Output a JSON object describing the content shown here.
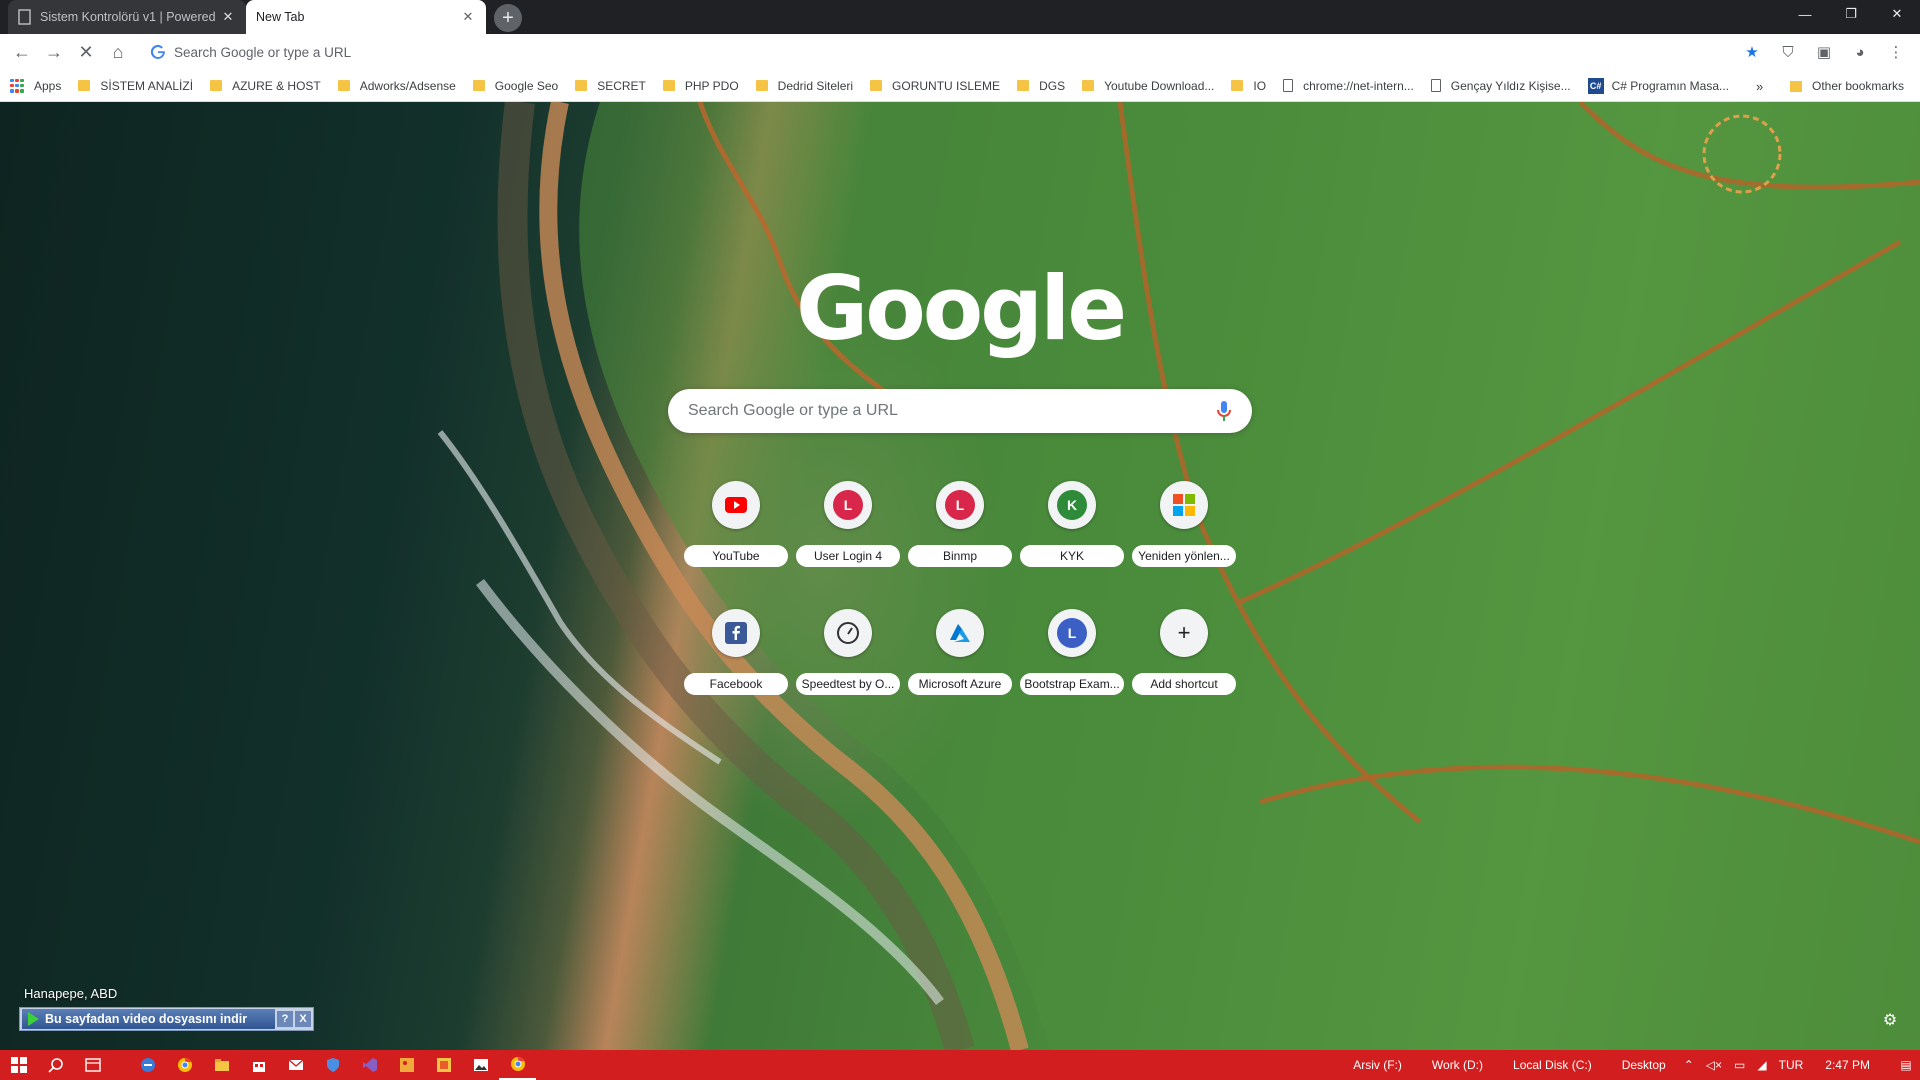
{
  "tabs": [
    {
      "title": "Sistem Kontrolörü v1 | Powered",
      "active": false
    },
    {
      "title": "New Tab",
      "active": true
    }
  ],
  "toolbar": {
    "omnibox_placeholder": "Search Google or type a URL"
  },
  "bookmarks": [
    {
      "label": "Apps",
      "icon": "apps-grid-icon"
    },
    {
      "label": "SİSTEM ANALİZİ",
      "icon": "folder-icon"
    },
    {
      "label": "AZURE & HOST",
      "icon": "folder-icon"
    },
    {
      "label": "Adworks/Adsense",
      "icon": "folder-icon"
    },
    {
      "label": "Google Seo",
      "icon": "folder-icon"
    },
    {
      "label": "SECRET",
      "icon": "folder-icon"
    },
    {
      "label": "PHP PDO",
      "icon": "folder-icon"
    },
    {
      "label": "Dedrid Siteleri",
      "icon": "folder-icon"
    },
    {
      "label": "GORUNTU ISLEME",
      "icon": "folder-icon"
    },
    {
      "label": "DGS",
      "icon": "folder-icon"
    },
    {
      "label": "Youtube Download...",
      "icon": "folder-icon"
    },
    {
      "label": "IO",
      "icon": "folder-icon"
    },
    {
      "label": "chrome://net-intern...",
      "icon": "page-icon"
    },
    {
      "label": "Gençay Yıldız Kişise...",
      "icon": "page-icon"
    },
    {
      "label": "C# Programın Masa...",
      "icon": "csharp-icon"
    }
  ],
  "bookmarks_overflow": "»",
  "other_bookmarks": "Other bookmarks",
  "ntp": {
    "logo": "Google",
    "search_placeholder": "Search Google or type a URL",
    "shortcuts": [
      {
        "label": "YouTube",
        "icon": "youtube-icon"
      },
      {
        "label": "User Login 4",
        "letter": "L",
        "color": "#d8274a"
      },
      {
        "label": "Binmp",
        "letter": "L",
        "color": "#d8274a"
      },
      {
        "label": "KYK",
        "letter": "K",
        "color": "#2e8b3a"
      },
      {
        "label": "Yeniden yönlen...",
        "icon": "microsoft-icon"
      },
      {
        "label": "Facebook",
        "icon": "facebook-icon"
      },
      {
        "label": "Speedtest by O...",
        "icon": "speedtest-icon"
      },
      {
        "label": "Microsoft Azure",
        "icon": "azure-icon"
      },
      {
        "label": "Bootstrap Exam...",
        "letter": "L",
        "color": "#3b5fc4"
      },
      {
        "label": "Add shortcut",
        "icon": "plus-icon"
      }
    ]
  },
  "background": {
    "location": "Hanapepe, ABD"
  },
  "video_bar": {
    "label": "Bu sayfadan video dosyasını indir",
    "help": "?",
    "close": "X"
  },
  "taskbar": {
    "color": "#d21e1e",
    "drives": [
      "Arsiv (F:)",
      "Work (D:)",
      "Local Disk (C:)",
      "Desktop"
    ],
    "language": "TUR",
    "time": "2:47 PM"
  }
}
